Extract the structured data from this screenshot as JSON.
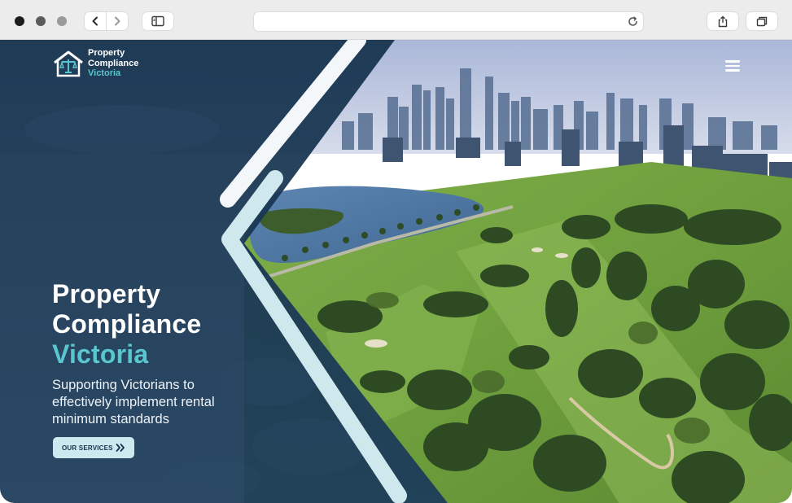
{
  "logo": {
    "line1": "Property",
    "line2": "Compliance",
    "line3": "Victoria"
  },
  "hero": {
    "title_line1": "Property",
    "title_line2": "Compliance",
    "title_accent": "Victoria",
    "subtitle": "Supporting Victorians to effectively implement rental minimum standards",
    "cta_label": "OUR SERVICES"
  },
  "icons": {
    "back": "chevron-left-icon",
    "forward": "chevron-right-icon",
    "sidebar": "sidebar-icon",
    "reload": "reload-icon",
    "share": "share-icon",
    "tabs": "tabs-icon",
    "menu": "hamburger-menu-icon",
    "cta": "double-chevron-right-icon"
  },
  "colors": {
    "navy": "#1c3a55",
    "accent": "#5ac7d0",
    "cta_bg": "#cbe9ef"
  }
}
